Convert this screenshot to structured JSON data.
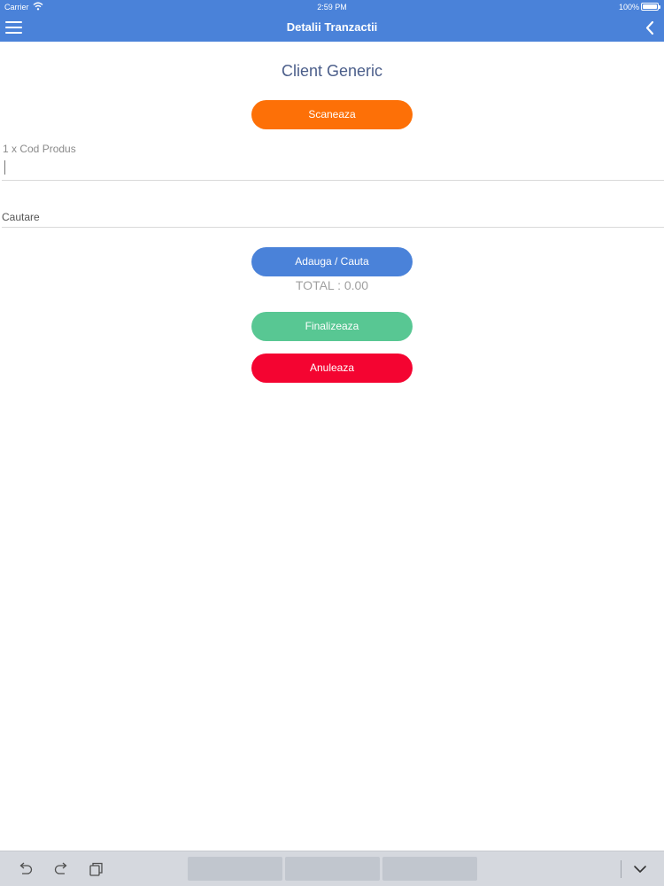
{
  "status_bar": {
    "carrier": "Carrier",
    "time": "2:59 PM",
    "battery": "100%"
  },
  "nav": {
    "title": "Detalii Tranzactii",
    "menu_icon": "menu-icon",
    "back_icon": "chevron-left-icon"
  },
  "client": {
    "name": "Client Generic"
  },
  "buttons": {
    "scan": "Scaneaza",
    "add_search": "Adauga / Cauta",
    "finish": "Finalizeaza",
    "cancel": "Anuleaza"
  },
  "fields": {
    "code_label": "1 x Cod Produs",
    "code_value": "",
    "search_placeholder": "Cautare",
    "search_value": ""
  },
  "total": {
    "text": "TOTAL : 0.00"
  },
  "keyboard_bar": {
    "icons": [
      "undo-icon",
      "redo-icon",
      "paste-icon",
      "keyboard-dismiss-icon"
    ],
    "suggestions": [
      "",
      "",
      ""
    ]
  },
  "colors": {
    "nav_bar": "#4a82d9",
    "scan_button": "#fd7007",
    "add_button": "#4a82d9",
    "finish_button": "#58c793",
    "cancel_button": "#f40431",
    "client_title": "#4b5e8a"
  }
}
